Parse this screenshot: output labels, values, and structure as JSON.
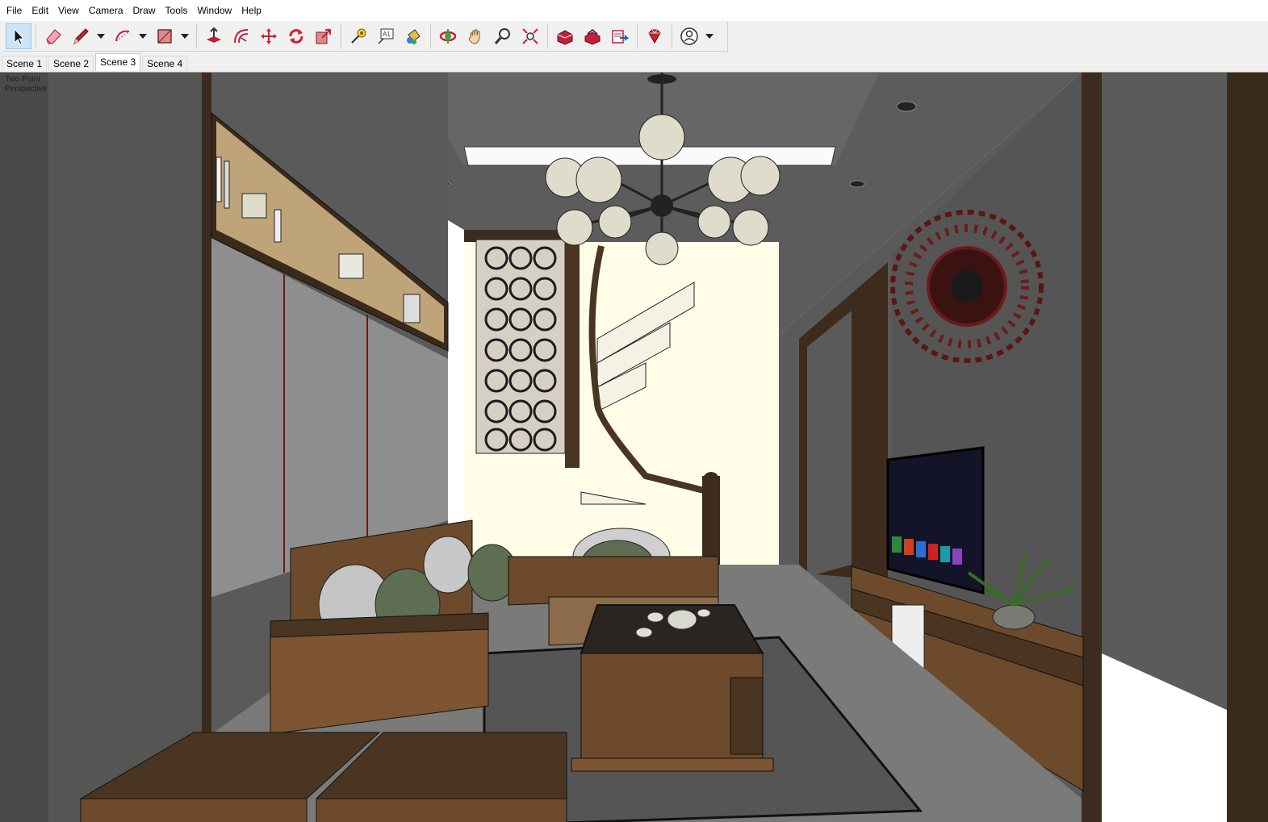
{
  "menu": [
    "File",
    "Edit",
    "View",
    "Camera",
    "Draw",
    "Tools",
    "Window",
    "Help"
  ],
  "toolbar": {
    "tools": [
      {
        "name": "select-tool",
        "icon": "arrow-cursor-icon",
        "active": true
      },
      {
        "name": "eraser-tool",
        "icon": "eraser-icon"
      },
      {
        "name": "line-tool",
        "icon": "pencil-icon",
        "dropdown": true
      },
      {
        "name": "arc-tool",
        "icon": "arc-icon",
        "dropdown": true
      },
      {
        "name": "shape-tool",
        "icon": "rectangle-icon",
        "dropdown": true
      },
      {
        "name": "push-pull-tool",
        "icon": "push-pull-icon"
      },
      {
        "name": "offset-tool",
        "icon": "offset-icon"
      },
      {
        "name": "move-tool",
        "icon": "move-icon"
      },
      {
        "name": "rotate-tool",
        "icon": "rotate-icon"
      },
      {
        "name": "scale-tool",
        "icon": "scale-icon"
      },
      {
        "name": "tape-measure-tool",
        "icon": "tape-measure-icon"
      },
      {
        "name": "text-tool",
        "icon": "text-icon"
      },
      {
        "name": "paint-bucket-tool",
        "icon": "paint-bucket-icon"
      },
      {
        "name": "orbit-tool",
        "icon": "orbit-icon"
      },
      {
        "name": "pan-tool",
        "icon": "hand-icon"
      },
      {
        "name": "zoom-tool",
        "icon": "magnifier-icon"
      },
      {
        "name": "zoom-extents-tool",
        "icon": "zoom-extents-icon"
      },
      {
        "name": "warehouse-tool",
        "icon": "warehouse-icon"
      },
      {
        "name": "extension-warehouse-tool",
        "icon": "extension-warehouse-icon"
      },
      {
        "name": "send-to-layout-tool",
        "icon": "layout-icon"
      },
      {
        "name": "extension-manager-tool",
        "icon": "ruby-gem-icon"
      },
      {
        "name": "account-tool",
        "icon": "user-account-icon",
        "dropdown": true
      }
    ],
    "text_tool_glyph": "A1"
  },
  "scenes": [
    "Scene 1",
    "Scene 2",
    "Scene 3",
    "Scene 4"
  ],
  "active_scene": "Scene 3",
  "viewport": {
    "view_label_line1": "Two Point",
    "view_label_line2": "Perspective"
  },
  "colors": {
    "selection_blue": "#cce4f7",
    "wall_grey": "#5a5a5a",
    "wood_dark": "#4a3522",
    "wood_mid": "#7a5533",
    "backlight": "#fffde8"
  }
}
